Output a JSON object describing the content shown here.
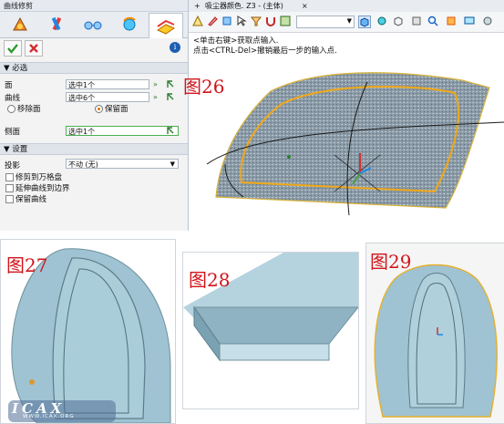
{
  "panel": {
    "title": "曲线修剪",
    "tab_icons": [
      "shape-icon",
      "pencil-tools-icon",
      "glasses-icon",
      "rotate-icon",
      "curve-trim-icon"
    ],
    "required_section": "必选",
    "face_label": "面",
    "face_value": "选中1个",
    "curve_label": "曲线",
    "curve_value": "选中6个",
    "remove_face_label": "移除面",
    "keep_face_label": "保留面",
    "side_face_label": "侧面",
    "side_face_value": "选中1个",
    "settings_section": "设置",
    "projection_label": "投影",
    "projection_value": "不动 (无)",
    "options": [
      "修剪到万格盘",
      "延伸曲线到边界",
      "保留曲线"
    ]
  },
  "viewport": {
    "tab_title": "吸尘器颜色. Z3 - (主体)",
    "hint_line1": "<单击右键>获取点输入.",
    "hint_line2": "点击<CTRL-Del>撤销最后一步的输入点."
  },
  "figures": {
    "fig26": "图26",
    "fig27": "图27",
    "fig28": "图28",
    "fig29": "图29"
  },
  "watermark": {
    "brand": "ICAX",
    "site": "WWW.ICAX.ORG"
  },
  "colors": {
    "accent": "#d0141b",
    "shape": "#9fc3d2",
    "highlight": "#f0a818"
  }
}
